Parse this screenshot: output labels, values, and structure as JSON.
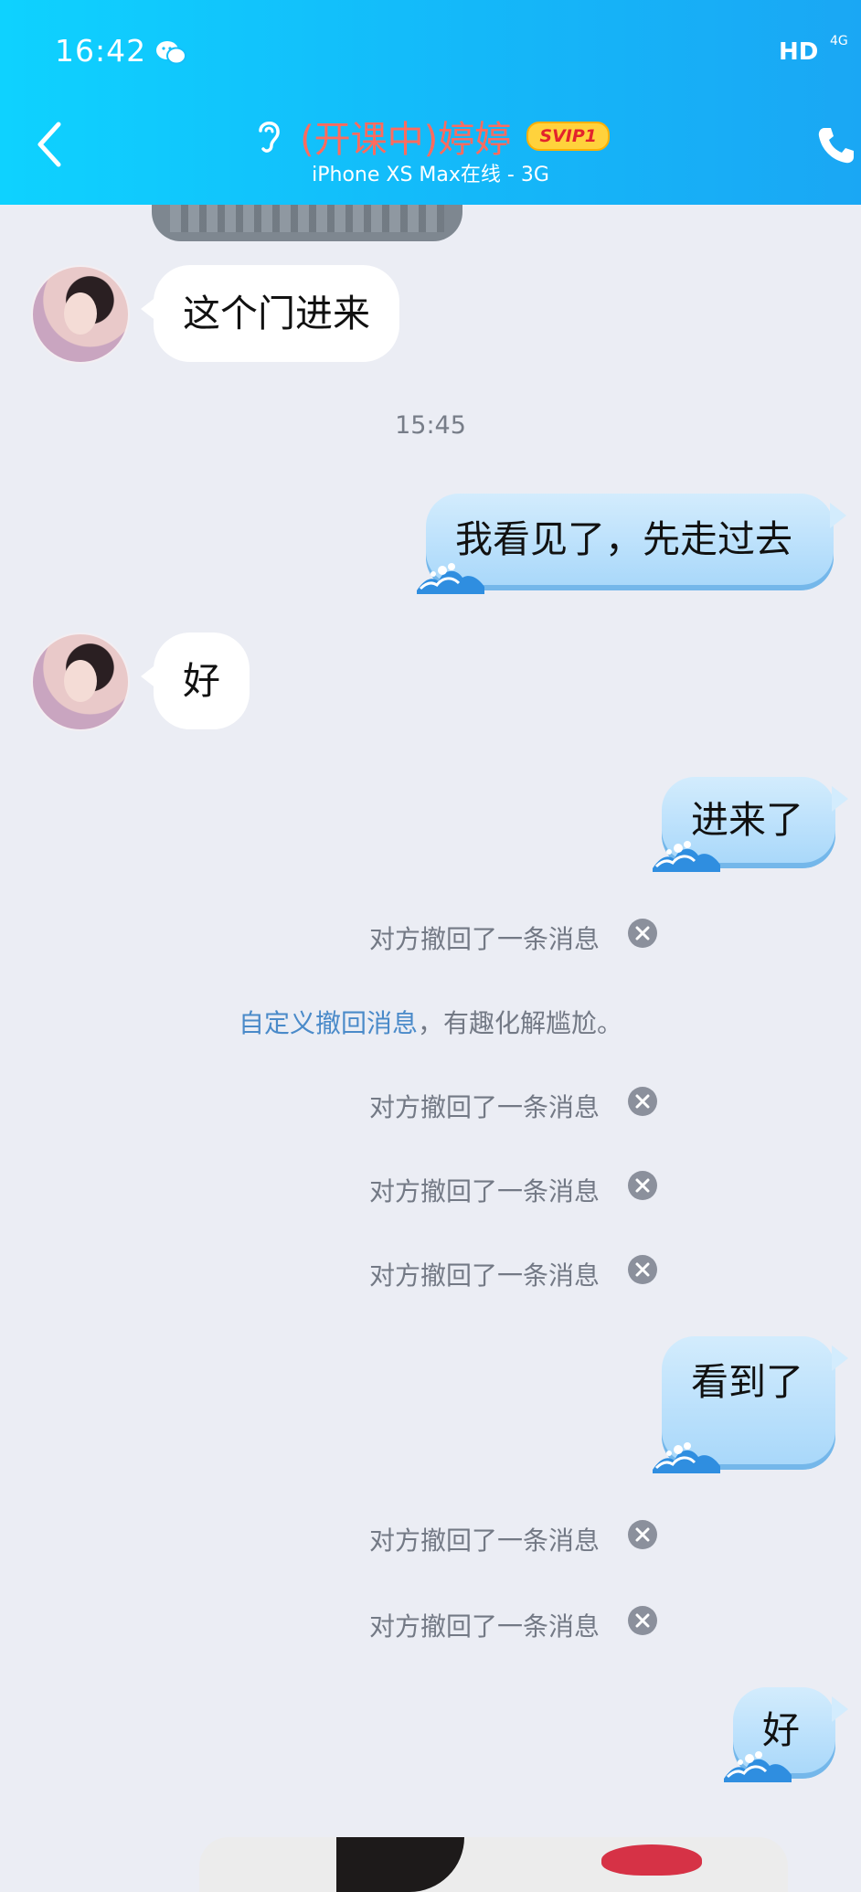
{
  "status_bar": {
    "time": "16:42",
    "hd_label": "HD",
    "network_label": "4G"
  },
  "header": {
    "title": "(开课中)婷婷",
    "badge": "SVIP1",
    "subtitle": "iPhone XS Max在线 - 3G"
  },
  "messages": {
    "m1": "这个门进来",
    "timestamp": "15:45",
    "m2": "我看见了，先走过去",
    "m3": "好",
    "m4": "进来了",
    "recall_text": "对方撤回了一条消息",
    "custom_recall_link": "自定义撤回消息",
    "custom_recall_rest": "，有趣化解尴尬。",
    "m5": "看到了",
    "m6": "好"
  },
  "colors": {
    "header_gradient_start": "#0ed2ff",
    "header_gradient_end": "#1aa7f4",
    "background": "#ebedf4",
    "title_color": "#ff6b5e",
    "link_color": "#4a8ac9",
    "outgoing_bubble": "#a7d7fa"
  },
  "icons": [
    "back-icon",
    "ear-icon",
    "phone-icon",
    "wechat-icon",
    "wave-icon",
    "close-icon"
  ]
}
